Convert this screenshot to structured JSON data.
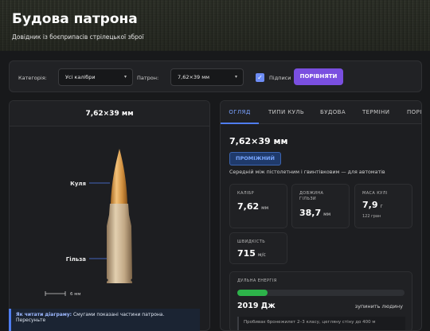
{
  "header": {
    "title": "Будова патрона",
    "subtitle": "Довідник із боєприпасів стрілецької зброї"
  },
  "filter": {
    "category_label": "Категорія:",
    "category_value": "Усі калібри",
    "cartridge_label": "Патрон:",
    "cartridge_value": "7,62×39 мм",
    "captions_label": "Підписи",
    "captions_checked": true,
    "compare_label": "ПОРІВНЯТИ"
  },
  "left_panel": {
    "title": "7,62×39 мм",
    "bullet_label": "Куля",
    "case_label": "Гільза",
    "scale_label": "6 мм",
    "note_bold": "Як читати діаграму:",
    "note_text": "Смугами показані частини патрона. Пересуньте"
  },
  "tabs": [
    "ОГЛЯД",
    "ТИПИ КУЛЬ",
    "БУДОВА",
    "ТЕРМІНИ",
    "ПОРІ"
  ],
  "overview": {
    "title": "7,62×39 мм",
    "badge": "ПРОМІЖНИЙ",
    "description": "Середній між пістолетним і гвинтівковим — для автоматів",
    "stats": [
      {
        "label": "КАЛІБР",
        "value": "7,62",
        "unit": "мм",
        "sub": ""
      },
      {
        "label": "ДОВЖИНА ГІЛЬЗИ",
        "value": "38,7",
        "unit": "мм",
        "sub": ""
      },
      {
        "label": "МАСА КУЛІ",
        "value": "7,9",
        "unit": "г",
        "sub": "122 гран"
      },
      {
        "label": "ШВИДКІСТЬ",
        "value": "715",
        "unit": "м/с",
        "sub": ""
      }
    ],
    "energy": {
      "label": "ДУЛЬНА ЕНЕРГІЯ",
      "value": "2019 Дж",
      "comparison": "зупинить людину",
      "fill_percent": 18,
      "bottom_text": "Пробиває бронежилет 2–3 класу, цегляну стіну до 400 м"
    }
  },
  "colors": {
    "accent": "#4f7df0",
    "compare": "#7a4fe0",
    "energy": "#2db34a",
    "badge_bg": "#1f3a6b",
    "badge_text": "#7aa7ff"
  }
}
